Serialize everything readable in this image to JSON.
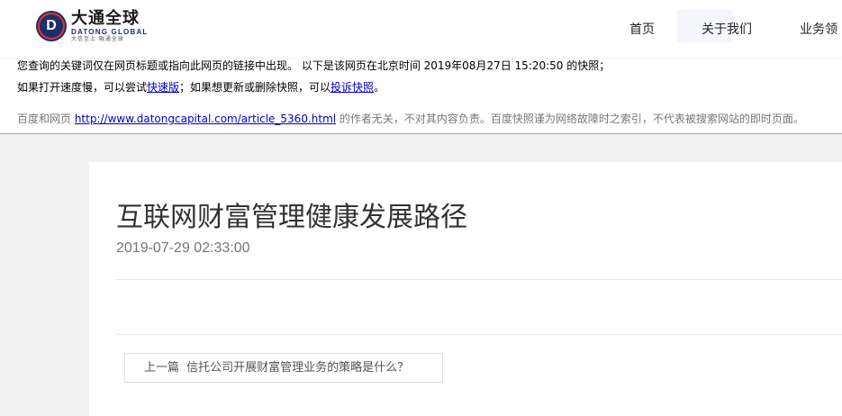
{
  "snapshot": {
    "line1": "您查询的关键词仅在网页标题或指向此网页的链接中出现。 以下是该网页在北京时间 2019年08月27日 15:20:50 的快照；",
    "line2_prefix": "如果打开速度慢，可以尝试",
    "fast_link": "快速版",
    "line2_mid": "；如果想更新或删除快照，可以",
    "complain_link": "投诉快照",
    "line2_suffix": "。",
    "disclaimer_prefix": "百度和网页 ",
    "source_url": "http://www.datongcapital.com/article_5360.html",
    "disclaimer_suffix": " 的作者无关，不对其内容负责。百度快照谨为网络故障时之索引，不代表被搜索网站的即时页面。"
  },
  "header": {
    "logo": {
      "mark": "D",
      "name_cn": "大通全球",
      "name_en": "DATONG GLOBAL",
      "slogan": "大信至上  融通全球"
    },
    "nav": [
      {
        "label": "首页"
      },
      {
        "label": "关于我们"
      },
      {
        "label": "业务领"
      }
    ]
  },
  "article": {
    "title": "互联网财富管理健康发展路径",
    "date": "2019-07-29 02:33:00",
    "prev_label": "上一篇",
    "prev_title": "信托公司开展财富管理业务的策略是什么？"
  },
  "colors": {
    "logo_navy": "#1c2f6b",
    "logo_red": "#d9392b",
    "link_blue": "#0000cc"
  }
}
